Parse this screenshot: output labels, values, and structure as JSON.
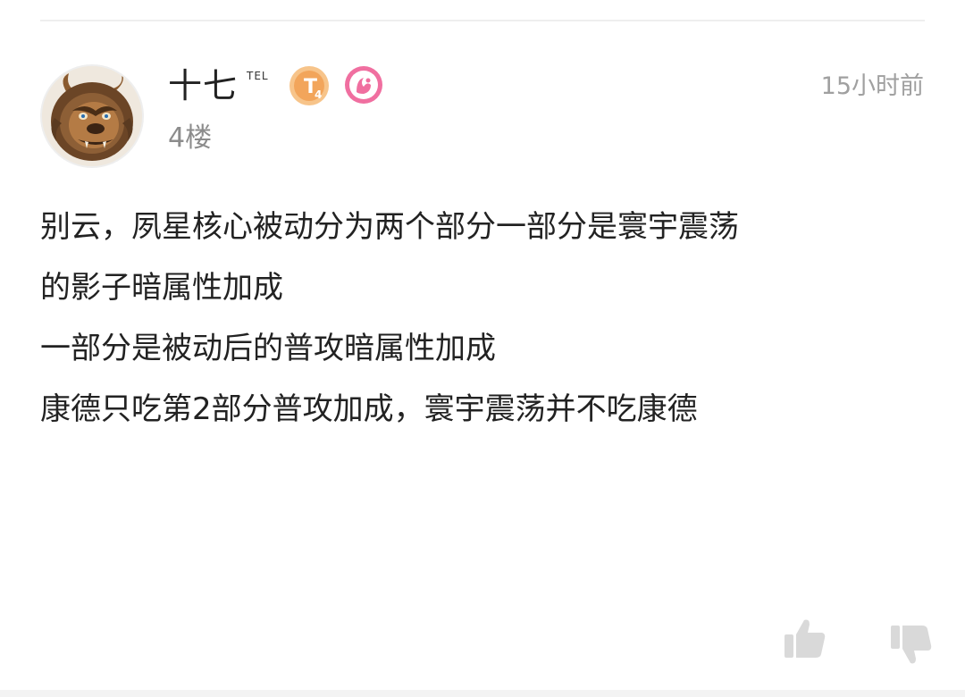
{
  "comment": {
    "user": {
      "name": "十七",
      "tag": "TEL",
      "avatar_icon": "beast-avatar-icon",
      "badges": [
        {
          "icon": "level-badge-icon",
          "text": "T",
          "sub": "4",
          "color": "#f5b36b"
        },
        {
          "icon": "pink-badge-icon",
          "color": "#f06fa0"
        }
      ]
    },
    "floor": "4楼",
    "time": "15小时前",
    "content_lines": [
      "别云，夙星核心被动分为两个部分一部分是寰宇震荡",
      "的影子暗属性加成",
      "一部分是被动后的普攻暗属性加成",
      "康德只吃第2部分普攻加成，寰宇震荡并不吃康德"
    ],
    "actions": {
      "like_icon": "thumbs-up-icon",
      "dislike_icon": "thumbs-down-icon"
    }
  },
  "colors": {
    "text": "#222222",
    "muted": "#a0a0a0",
    "icon": "#d9d9d9"
  }
}
